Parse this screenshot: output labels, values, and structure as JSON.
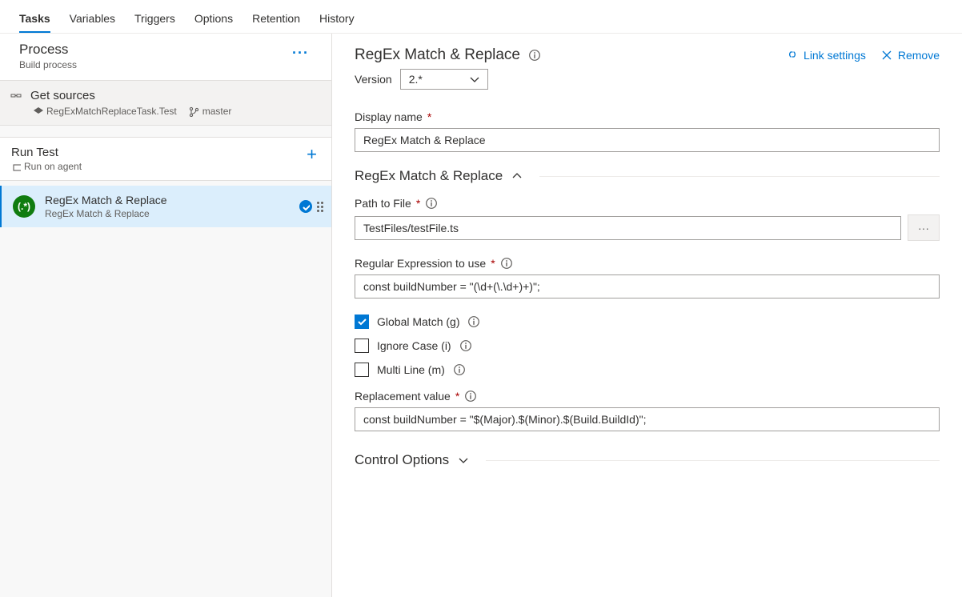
{
  "tabs": {
    "tasks": "Tasks",
    "variables": "Variables",
    "triggers": "Triggers",
    "options": "Options",
    "retention": "Retention",
    "history": "History"
  },
  "process": {
    "title": "Process",
    "subtitle": "Build process"
  },
  "get_sources": {
    "title": "Get sources",
    "repo": "RegExMatchReplaceTask.Test",
    "branch": "master"
  },
  "phase": {
    "title": "Run Test",
    "subtitle": "Run on agent"
  },
  "task": {
    "title": "RegEx Match & Replace",
    "subtitle": "RegEx Match & Replace",
    "badge_text": "(.*)"
  },
  "content_header": {
    "title": "RegEx Match & Replace",
    "link_settings": "Link settings",
    "remove": "Remove"
  },
  "version": {
    "label": "Version",
    "selected": "2.*"
  },
  "display_name": {
    "label": "Display name",
    "value": "RegEx Match & Replace"
  },
  "section": {
    "title": "RegEx Match & Replace"
  },
  "path_to_file": {
    "label": "Path to File",
    "value": "TestFiles/testFile.ts"
  },
  "regex": {
    "label": "Regular Expression to use",
    "value": "const buildNumber = \"(\\d+(\\.\\d+)+)\";"
  },
  "checkboxes": {
    "global": "Global Match (g)",
    "ignore": "Ignore Case (i)",
    "multiline": "Multi Line (m)"
  },
  "replacement": {
    "label": "Replacement value",
    "value": "const buildNumber = \"$(Major).$(Minor).$(Build.BuildId)\";"
  },
  "control_options": {
    "title": "Control Options"
  }
}
